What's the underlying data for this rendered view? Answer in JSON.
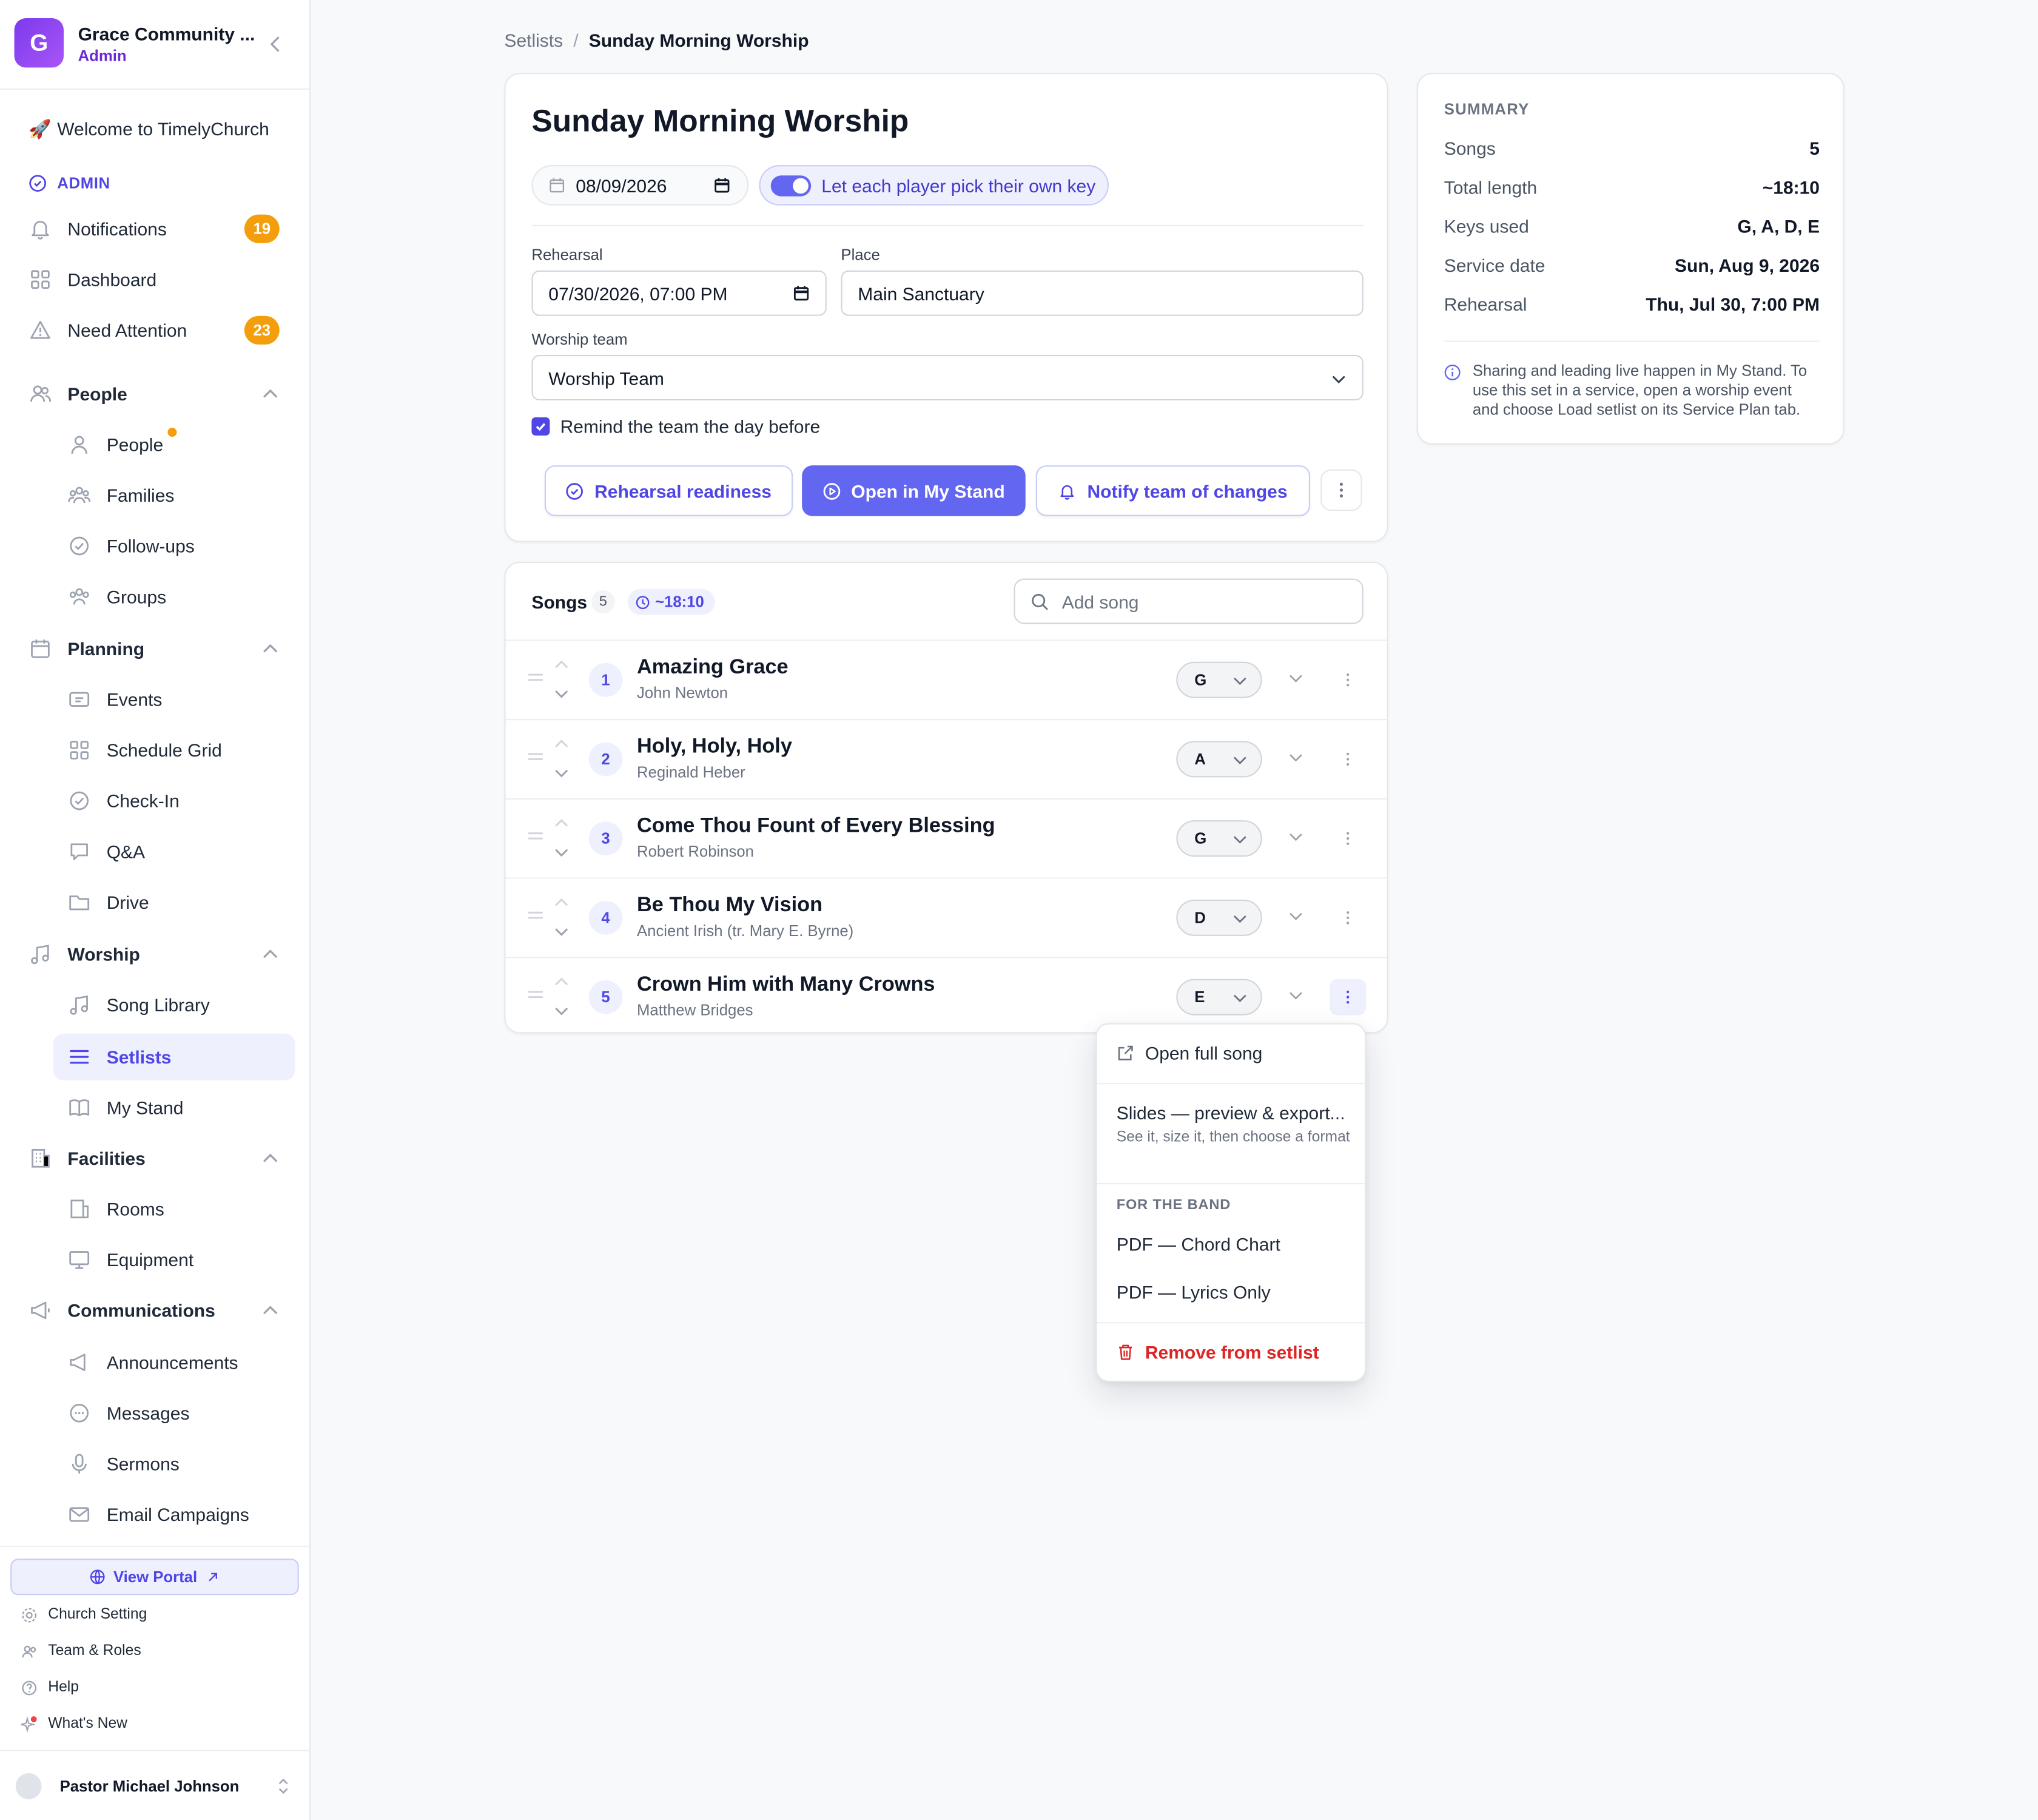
{
  "sidebar": {
    "org_initial": "G",
    "org_name": "Grace Community ...",
    "org_role": "Admin",
    "welcome": "Welcome to TimelyChurch",
    "admin_label": "ADMIN",
    "top_items": [
      {
        "label": "Notifications",
        "badge": "19"
      },
      {
        "label": "Dashboard"
      },
      {
        "label": "Need Attention",
        "badge": "23"
      }
    ],
    "groups": {
      "people": {
        "label": "People",
        "items": [
          "People",
          "Families",
          "Follow-ups",
          "Groups"
        ]
      },
      "planning": {
        "label": "Planning",
        "items": [
          "Events",
          "Schedule Grid",
          "Check-In",
          "Q&A",
          "Drive"
        ]
      },
      "worship": {
        "label": "Worship",
        "items": [
          "Song Library",
          "Setlists",
          "My Stand"
        ]
      },
      "facilities": {
        "label": "Facilities",
        "items": [
          "Rooms",
          "Equipment"
        ]
      },
      "communications": {
        "label": "Communications",
        "items": [
          "Announcements",
          "Messages",
          "Sermons",
          "Email Campaigns"
        ]
      }
    },
    "view_portal": "View Portal",
    "footer": [
      "Church Setting",
      "Team & Roles",
      "Help",
      "What's New"
    ],
    "user_name": "Pastor Michael Johnson"
  },
  "breadcrumb": {
    "parent": "Setlists",
    "separator": "/",
    "current": "Sunday Morning Worship"
  },
  "setlist": {
    "title": "Sunday Morning Worship",
    "date": "08/09/2026",
    "own_key_toggle": "Let each player pick their own key",
    "rehearsal_label": "Rehearsal",
    "rehearsal_value": "07/30/2026, 07:00 PM",
    "place_label": "Place",
    "place_value": "Main Sanctuary",
    "team_label": "Worship team",
    "team_value": "Worship Team",
    "remind_label": "Remind the team the day before",
    "btn_readiness": "Rehearsal readiness",
    "btn_open_stand": "Open in My Stand",
    "btn_notify": "Notify team of changes"
  },
  "songs": {
    "label": "Songs",
    "count": "5",
    "duration": "~18:10",
    "search_placeholder": "Add song",
    "items": [
      {
        "num": "1",
        "title": "Amazing Grace",
        "author": "John Newton",
        "key": "G"
      },
      {
        "num": "2",
        "title": "Holy, Holy, Holy",
        "author": "Reginald Heber",
        "key": "A"
      },
      {
        "num": "3",
        "title": "Come Thou Fount of Every Blessing",
        "author": "Robert Robinson",
        "key": "G"
      },
      {
        "num": "4",
        "title": "Be Thou My Vision",
        "author": "Ancient Irish (tr. Mary E. Byrne)",
        "key": "D"
      },
      {
        "num": "5",
        "title": "Crown Him with Many Crowns",
        "author": "Matthew Bridges",
        "key": "E"
      }
    ]
  },
  "summary": {
    "heading": "SUMMARY",
    "rows": [
      {
        "k": "Songs",
        "v": "5"
      },
      {
        "k": "Total length",
        "v": "~18:10"
      },
      {
        "k": "Keys used",
        "v": "G, A, D, E"
      },
      {
        "k": "Service date",
        "v": "Sun, Aug 9, 2026"
      },
      {
        "k": "Rehearsal",
        "v": "Thu, Jul 30, 7:00 PM"
      }
    ],
    "note": "Sharing and leading live happen in My Stand. To use this set in a service, open a worship event and choose Load setlist on its Service Plan tab."
  },
  "menu": {
    "open_full": "Open full song",
    "slides": "Slides — preview & export...",
    "slides_sub": "See it, size it, then choose a format",
    "section": "FOR THE BAND",
    "pdf_chord": "PDF — Chord Chart",
    "pdf_lyrics": "PDF — Lyrics Only",
    "remove": "Remove from setlist"
  },
  "colors": {
    "accent": "#6366f1",
    "badge": "#f59e0b",
    "danger": "#dc2626"
  }
}
